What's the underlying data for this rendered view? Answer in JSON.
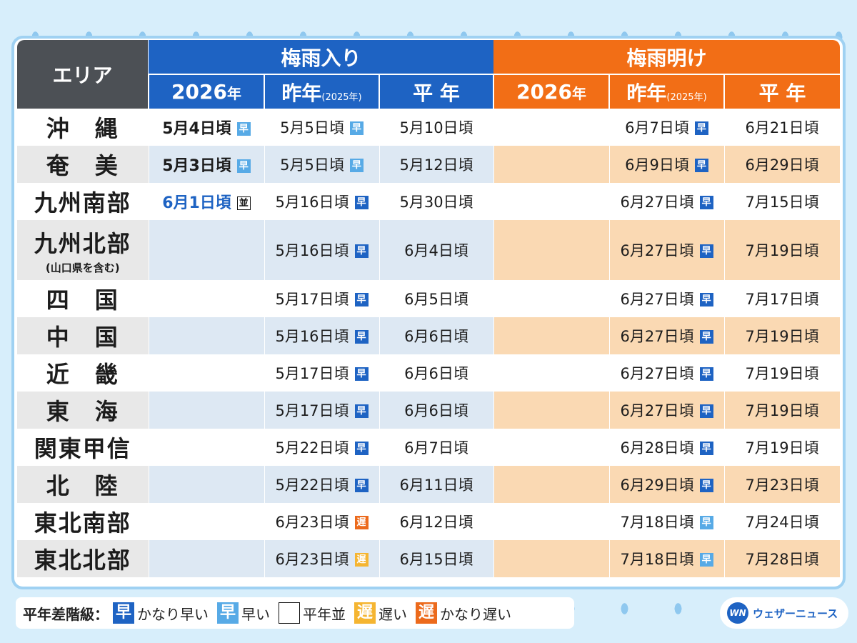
{
  "header": {
    "area": "エリア",
    "start_group": "梅雨入り",
    "end_group": "梅雨明け",
    "col_current_year": "2026",
    "col_current_unit": "年",
    "col_last_year": "昨年",
    "col_last_year_sub": "(2025年)",
    "col_normal": "平 年"
  },
  "rows": [
    {
      "area": "沖　縄",
      "area_sub": "",
      "s_cur": "5月4日頃",
      "s_cur_badge": "早",
      "s_cur_badge_type": "early",
      "s_cur_color": "",
      "s_last": "5月5日頃",
      "s_last_badge": "早",
      "s_last_badge_type": "early",
      "s_norm": "5月10日頃",
      "e_cur": "",
      "e_last": "6月7日頃",
      "e_last_badge": "早",
      "e_last_badge_type": "veryearly",
      "e_norm": "6月21日頃"
    },
    {
      "area": "奄　美",
      "area_sub": "",
      "s_cur": "5月3日頃",
      "s_cur_badge": "早",
      "s_cur_badge_type": "early",
      "s_cur_color": "",
      "s_last": "5月5日頃",
      "s_last_badge": "早",
      "s_last_badge_type": "early",
      "s_norm": "5月12日頃",
      "e_cur": "",
      "e_last": "6月9日頃",
      "e_last_badge": "早",
      "e_last_badge_type": "veryearly",
      "e_norm": "6月29日頃"
    },
    {
      "area": "九州南部",
      "area_sub": "",
      "s_cur": "6月1日頃",
      "s_cur_badge": "並",
      "s_cur_badge_type": "normal",
      "s_cur_color": "blue",
      "s_last": "5月16日頃",
      "s_last_badge": "早",
      "s_last_badge_type": "veryearly",
      "s_norm": "5月30日頃",
      "e_cur": "",
      "e_last": "6月27日頃",
      "e_last_badge": "早",
      "e_last_badge_type": "veryearly",
      "e_norm": "7月15日頃"
    },
    {
      "area": "九州北部",
      "area_sub": "(山口県を含む)",
      "s_cur": "",
      "s_cur_badge": "",
      "s_cur_badge_type": "",
      "s_cur_color": "",
      "s_last": "5月16日頃",
      "s_last_badge": "早",
      "s_last_badge_type": "veryearly",
      "s_norm": "6月4日頃",
      "e_cur": "",
      "e_last": "6月27日頃",
      "e_last_badge": "早",
      "e_last_badge_type": "veryearly",
      "e_norm": "7月19日頃"
    },
    {
      "area": "四　国",
      "area_sub": "",
      "s_cur": "",
      "s_cur_badge": "",
      "s_cur_badge_type": "",
      "s_cur_color": "",
      "s_last": "5月17日頃",
      "s_last_badge": "早",
      "s_last_badge_type": "veryearly",
      "s_norm": "6月5日頃",
      "e_cur": "",
      "e_last": "6月27日頃",
      "e_last_badge": "早",
      "e_last_badge_type": "veryearly",
      "e_norm": "7月17日頃"
    },
    {
      "area": "中　国",
      "area_sub": "",
      "s_cur": "",
      "s_cur_badge": "",
      "s_cur_badge_type": "",
      "s_cur_color": "",
      "s_last": "5月16日頃",
      "s_last_badge": "早",
      "s_last_badge_type": "veryearly",
      "s_norm": "6月6日頃",
      "e_cur": "",
      "e_last": "6月27日頃",
      "e_last_badge": "早",
      "e_last_badge_type": "veryearly",
      "e_norm": "7月19日頃"
    },
    {
      "area": "近　畿",
      "area_sub": "",
      "s_cur": "",
      "s_cur_badge": "",
      "s_cur_badge_type": "",
      "s_cur_color": "",
      "s_last": "5月17日頃",
      "s_last_badge": "早",
      "s_last_badge_type": "veryearly",
      "s_norm": "6月6日頃",
      "e_cur": "",
      "e_last": "6月27日頃",
      "e_last_badge": "早",
      "e_last_badge_type": "veryearly",
      "e_norm": "7月19日頃"
    },
    {
      "area": "東　海",
      "area_sub": "",
      "s_cur": "",
      "s_cur_badge": "",
      "s_cur_badge_type": "",
      "s_cur_color": "",
      "s_last": "5月17日頃",
      "s_last_badge": "早",
      "s_last_badge_type": "veryearly",
      "s_norm": "6月6日頃",
      "e_cur": "",
      "e_last": "6月27日頃",
      "e_last_badge": "早",
      "e_last_badge_type": "veryearly",
      "e_norm": "7月19日頃"
    },
    {
      "area": "関東甲信",
      "area_sub": "",
      "s_cur": "",
      "s_cur_badge": "",
      "s_cur_badge_type": "",
      "s_cur_color": "",
      "s_last": "5月22日頃",
      "s_last_badge": "早",
      "s_last_badge_type": "veryearly",
      "s_norm": "6月7日頃",
      "e_cur": "",
      "e_last": "6月28日頃",
      "e_last_badge": "早",
      "e_last_badge_type": "veryearly",
      "e_norm": "7月19日頃"
    },
    {
      "area": "北　陸",
      "area_sub": "",
      "s_cur": "",
      "s_cur_badge": "",
      "s_cur_badge_type": "",
      "s_cur_color": "",
      "s_last": "5月22日頃",
      "s_last_badge": "早",
      "s_last_badge_type": "veryearly",
      "s_norm": "6月11日頃",
      "e_cur": "",
      "e_last": "6月29日頃",
      "e_last_badge": "早",
      "e_last_badge_type": "veryearly",
      "e_norm": "7月23日頃"
    },
    {
      "area": "東北南部",
      "area_sub": "",
      "s_cur": "",
      "s_cur_badge": "",
      "s_cur_badge_type": "",
      "s_cur_color": "",
      "s_last": "6月23日頃",
      "s_last_badge": "遅",
      "s_last_badge_type": "verylate",
      "s_norm": "6月12日頃",
      "e_cur": "",
      "e_last": "7月18日頃",
      "e_last_badge": "早",
      "e_last_badge_type": "early",
      "e_norm": "7月24日頃"
    },
    {
      "area": "東北北部",
      "area_sub": "",
      "s_cur": "",
      "s_cur_badge": "",
      "s_cur_badge_type": "",
      "s_cur_color": "",
      "s_last": "6月23日頃",
      "s_last_badge": "遅",
      "s_last_badge_type": "late",
      "s_norm": "6月15日頃",
      "e_cur": "",
      "e_last": "7月18日頃",
      "e_last_badge": "早",
      "e_last_badge_type": "early",
      "e_norm": "7月28日頃"
    }
  ],
  "legend": {
    "title": "平年差階級：",
    "items": [
      {
        "badge": "早",
        "type": "veryearly",
        "label": "かなり早い"
      },
      {
        "badge": "早",
        "type": "early",
        "label": "早い"
      },
      {
        "badge": "並",
        "type": "normal",
        "label": "平年並"
      },
      {
        "badge": "遅",
        "type": "late",
        "label": "遅い"
      },
      {
        "badge": "遅",
        "type": "verylate",
        "label": "かなり遅い"
      }
    ]
  },
  "logo": {
    "mark": "WN",
    "text": "ウェザーニュース"
  },
  "colors": {
    "start_header": "#1e63c3",
    "end_header": "#f26e16",
    "area_header": "#4c5055",
    "badge_veryearly": "#1e63c3",
    "badge_early": "#57aae6",
    "badge_late": "#f5b531",
    "badge_verylate": "#ec6a1c",
    "background": "#d7eefb"
  }
}
